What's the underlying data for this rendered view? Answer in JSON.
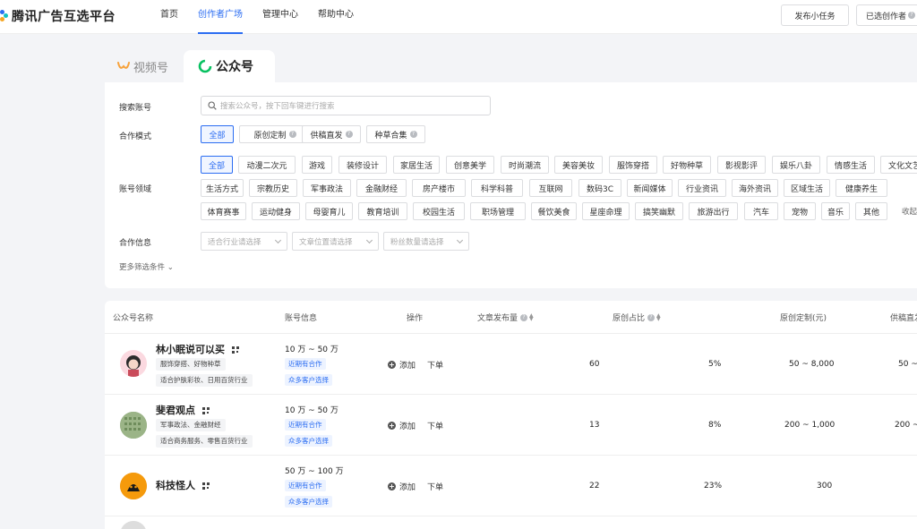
{
  "app": {
    "title": "腾讯广告互选平台"
  },
  "nav": {
    "items": [
      "首页",
      "创作者广场",
      "管理中心",
      "帮助中心"
    ],
    "active_index": 1
  },
  "header_buttons": {
    "publish_task": "发布小任务",
    "selected_creators": "已选创作者"
  },
  "tabs": {
    "video": "视频号",
    "official": "公众号",
    "active": "公众号"
  },
  "filters": {
    "search_label": "搜索账号",
    "search_placeholder": "搜索公众号，按下回车键进行搜索",
    "coop_mode_label": "合作模式",
    "coop_modes": [
      "全部",
      "原创定制",
      "供稿直发",
      "种草合集"
    ],
    "domain_label": "账号领域",
    "domains_row1": [
      "全部",
      "动漫二次元",
      "游戏",
      "装修设计",
      "家居生活",
      "创意美学",
      "时尚潮流",
      "美容美妆",
      "服饰穿搭",
      "好物种草",
      "影视影评",
      "娱乐八卦",
      "情感生活",
      "文化文艺"
    ],
    "domains_row2": [
      "生活方式",
      "宗教历史",
      "军事政法",
      "金融财经",
      "房产楼市",
      "科学科普",
      "互联网",
      "数码3C",
      "新闻媒体",
      "行业资讯",
      "海外资讯",
      "区域生活",
      "健康养生"
    ],
    "domains_row3": [
      "体育赛事",
      "运动健身",
      "母婴育儿",
      "教育培训",
      "校园生活",
      "职场管理",
      "餐饮美食",
      "星座命理",
      "搞笑幽默",
      "旅游出行",
      "汽车",
      "宠物",
      "音乐",
      "其他"
    ],
    "fold": "收起",
    "coop_info_label": "合作信息",
    "coop_selects": [
      "适合行业请选择",
      "文章位置请选择",
      "粉丝数量请选择"
    ],
    "more": "更多筛选条件 ⌄"
  },
  "table": {
    "headers": {
      "name": "公众号名称",
      "info": "账号信息",
      "op": "操作",
      "articles": "文章发布量",
      "original_ratio": "原创占比",
      "custom": "原创定制(元)",
      "supply": "供稿直发"
    },
    "add_label": "添加",
    "order_label": "下单",
    "rows": [
      {
        "name": "林小眠说可以买",
        "tags": [
          "服饰穿搭、好物种草",
          "适合护肤彩妆、日用百货行业"
        ],
        "fans": "10 万 ~ 50 万",
        "badges": [
          "近期有合作",
          "众多客户选择"
        ],
        "articles": "60",
        "ratio": "5%",
        "custom": "50 ~ 8,000",
        "supply": "50 ~"
      },
      {
        "name": "斐君观点",
        "tags": [
          "军事政法、金融财经",
          "适合商务服务、零售百货行业"
        ],
        "fans": "10 万 ~ 50 万",
        "badges": [
          "近期有合作",
          "众多客户选择"
        ],
        "articles": "13",
        "ratio": "8%",
        "custom": "200 ~ 1,000",
        "supply": "200 ~"
      },
      {
        "name": "科技怪人",
        "tags": [],
        "fans": "50 万 ~ 100 万",
        "badges": [
          "近期有合作",
          "众多客户选择"
        ],
        "articles": "22",
        "ratio": "23%",
        "custom": "300",
        "supply": ""
      }
    ]
  },
  "colors": {
    "accent": "#2b6df2",
    "wechat_green": "#07c160",
    "video_orange": "#f7a23b"
  }
}
